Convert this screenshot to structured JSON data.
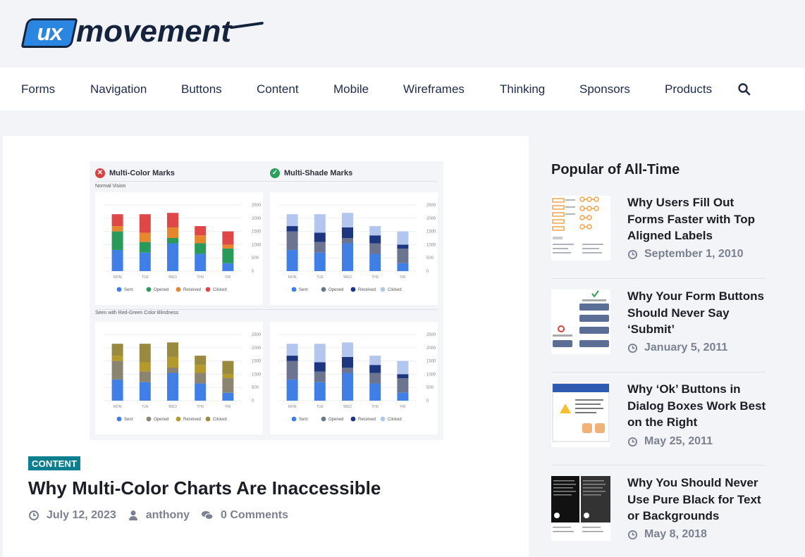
{
  "brand": {
    "mark": "ux",
    "word": "movement"
  },
  "nav": {
    "items": [
      "Forms",
      "Navigation",
      "Buttons",
      "Content",
      "Mobile",
      "Wireframes",
      "Thinking",
      "Sponsors",
      "Products"
    ],
    "search_icon": "search-icon"
  },
  "article": {
    "category": "CONTENT",
    "title": "Why Multi-Color Charts Are Inaccessible",
    "date": "July 12, 2023",
    "author": "anthony",
    "comments": "0 Comments",
    "hero": {
      "left_heading": "Multi-Color Marks",
      "right_heading": "Multi-Shade Marks",
      "section_normal": "Normal Vision",
      "section_cb": "Seen with Red-Green Color Blindness",
      "y_ticks": [
        "2500",
        "2000",
        "1500",
        "1000",
        "500",
        "0"
      ],
      "days": [
        "MON",
        "TUE",
        "WED",
        "THU",
        "FRI"
      ],
      "legend": [
        "Sent",
        "Opened",
        "Received",
        "Clicked"
      ],
      "stack_values": [
        [
          800,
          700,
          1050,
          650,
          300
        ],
        [
          700,
          400,
          200,
          400,
          550
        ],
        [
          200,
          350,
          400,
          300,
          150
        ],
        [
          450,
          700,
          550,
          350,
          500
        ]
      ],
      "palettes": {
        "multi_color": [
          "#3f7fe6",
          "#2a9a5a",
          "#e6862f",
          "#e04848"
        ],
        "multi_shade": [
          "#3f7fe6",
          "#6b7590",
          "#1c3680",
          "#b3c7ee"
        ],
        "multi_color_cb": [
          "#3f7fe6",
          "#8b8470",
          "#b39a2a",
          "#9a8a40"
        ],
        "multi_shade_cb": [
          "#3f7fe6",
          "#6b7590",
          "#1c3680",
          "#b3c7ee"
        ]
      }
    }
  },
  "sidebar": {
    "heading": "Popular of All-Time",
    "posts": [
      {
        "title": "Why Users Fill Out Forms Faster with Top Aligned Labels",
        "date": "September 1, 2010"
      },
      {
        "title": "Why Your Form Buttons Should Never Say ‘Submit’",
        "date": "January 5, 2011"
      },
      {
        "title": "Why ‘Ok’ Buttons in Dialog Boxes Work Best on the Right",
        "date": "May 25, 2011"
      },
      {
        "title": "Why You Should Never Use Pure Black for Text or Backgrounds",
        "date": "May 8, 2018"
      }
    ]
  },
  "colors": {
    "accent": "#0b7f8f",
    "nav_text": "#1d2a4a",
    "bad": "#d94040",
    "good": "#2aa05a"
  }
}
